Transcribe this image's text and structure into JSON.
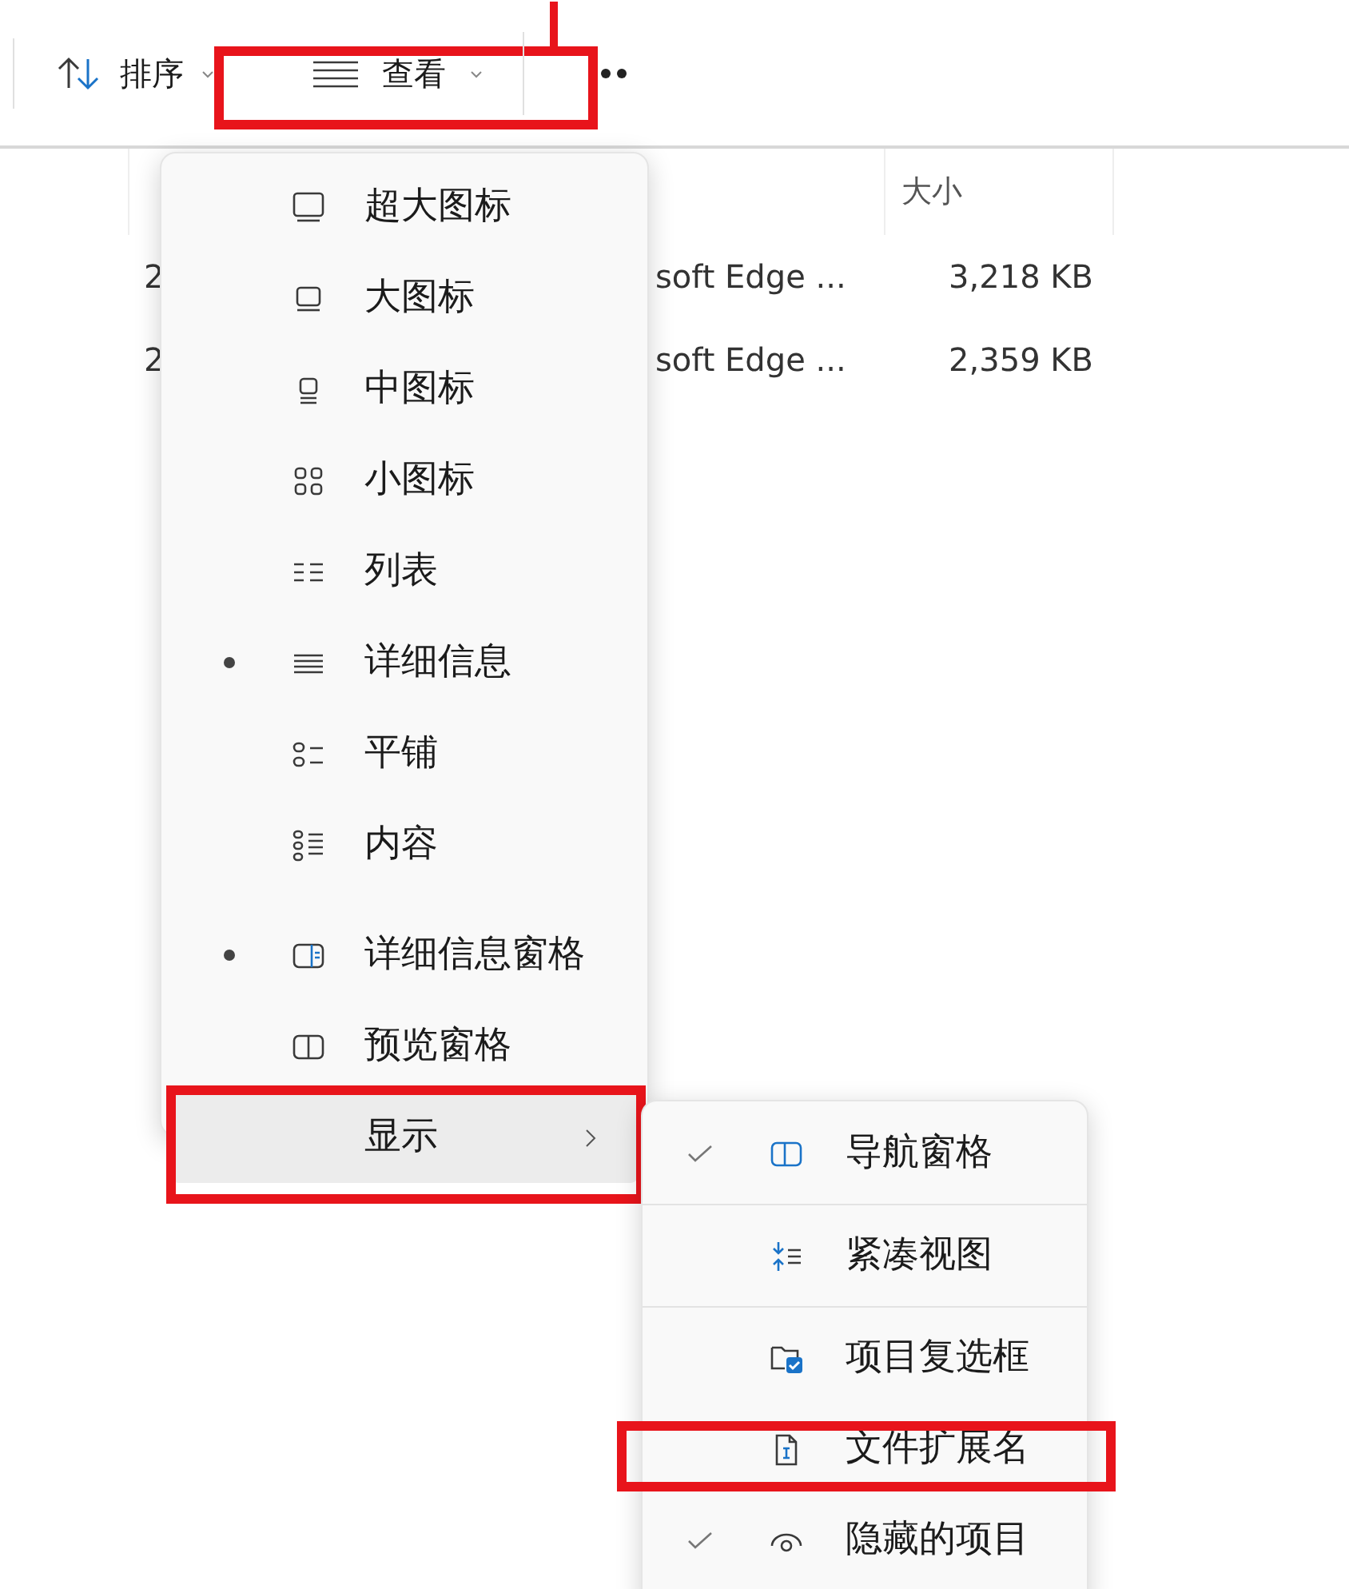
{
  "toolbar": {
    "items": [
      {
        "kind": "sort",
        "label": "排序",
        "highlighted": false
      },
      {
        "kind": "view",
        "label": "查看",
        "highlighted": true
      },
      {
        "kind": "more"
      }
    ]
  },
  "table": {
    "columns": [
      {
        "label": "大小"
      }
    ],
    "rows": [
      {
        "column_1": "2",
        "column_2": "soft Edge ...",
        "size": "3,218 KB"
      },
      {
        "column_1": "2",
        "column_2": "soft Edge ...",
        "size": "2,359 KB"
      }
    ]
  },
  "view_menu": {
    "items": [
      {
        "kind": "item",
        "label": "超大图标",
        "selected": false,
        "highlighted": false
      },
      {
        "kind": "item",
        "label": "大图标",
        "selected": false,
        "highlighted": false
      },
      {
        "kind": "item",
        "label": "中图标",
        "selected": false,
        "highlighted": false
      },
      {
        "kind": "item",
        "label": "小图标",
        "selected": false,
        "highlighted": false
      },
      {
        "kind": "item",
        "label": "列表",
        "selected": false,
        "highlighted": false
      },
      {
        "kind": "item",
        "label": "详细信息",
        "selected": true,
        "highlighted": false
      },
      {
        "kind": "item",
        "label": "平铺",
        "selected": false,
        "highlighted": false
      },
      {
        "kind": "item",
        "label": "内容",
        "selected": false,
        "highlighted": false
      },
      {
        "kind": "divider"
      },
      {
        "kind": "item",
        "label": "详细信息窗格",
        "selected": true,
        "highlighted": false
      },
      {
        "kind": "item",
        "label": "预览窗格",
        "selected": false,
        "highlighted": false
      },
      {
        "kind": "submenu",
        "label": "显示",
        "selected": false,
        "highlighted": true
      }
    ]
  },
  "show_submenu": {
    "items": [
      {
        "kind": "item",
        "label": "导航窗格",
        "checked": true,
        "highlighted": false
      },
      {
        "kind": "divider"
      },
      {
        "kind": "item",
        "label": "紧凑视图",
        "checked": false,
        "highlighted": false
      },
      {
        "kind": "divider"
      },
      {
        "kind": "item",
        "label": "项目复选框",
        "checked": false,
        "highlighted": false
      },
      {
        "kind": "item",
        "label": "文件扩展名",
        "checked": false,
        "highlighted": true
      },
      {
        "kind": "item",
        "label": "隐藏的项目",
        "checked": true,
        "highlighted": false
      }
    ]
  }
}
